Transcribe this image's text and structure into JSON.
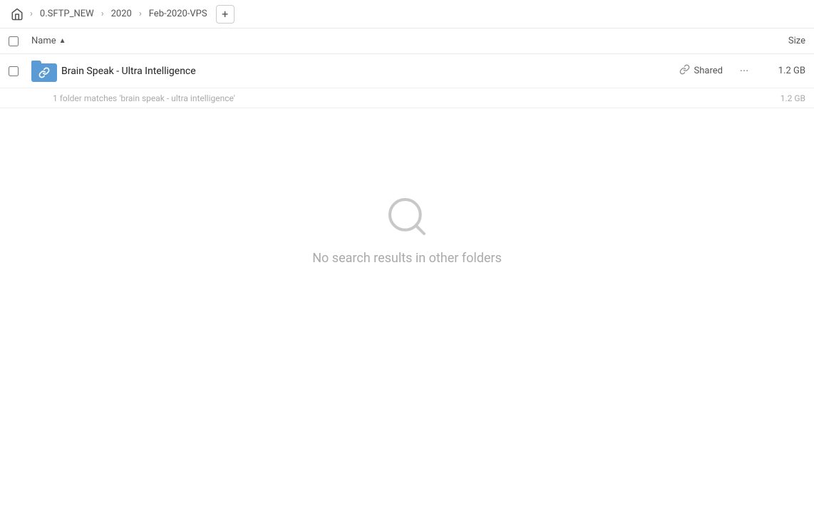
{
  "breadcrumb": {
    "home_icon": "home",
    "items": [
      {
        "label": "0.SFTP_NEW"
      },
      {
        "label": "2020"
      },
      {
        "label": "Feb-2020-VPS"
      }
    ],
    "add_button_label": "+"
  },
  "columns": {
    "name_label": "Name",
    "sort_indicator": "▲",
    "size_label": "Size"
  },
  "file_row": {
    "name": "Brain Speak - Ultra Intelligence",
    "shared_label": "Shared",
    "size": "1.2 GB"
  },
  "match_count": {
    "text": "1 folder matches 'brain speak - ultra intelligence'",
    "size": "1.2 GB"
  },
  "empty_state": {
    "message": "No search results in other folders"
  }
}
